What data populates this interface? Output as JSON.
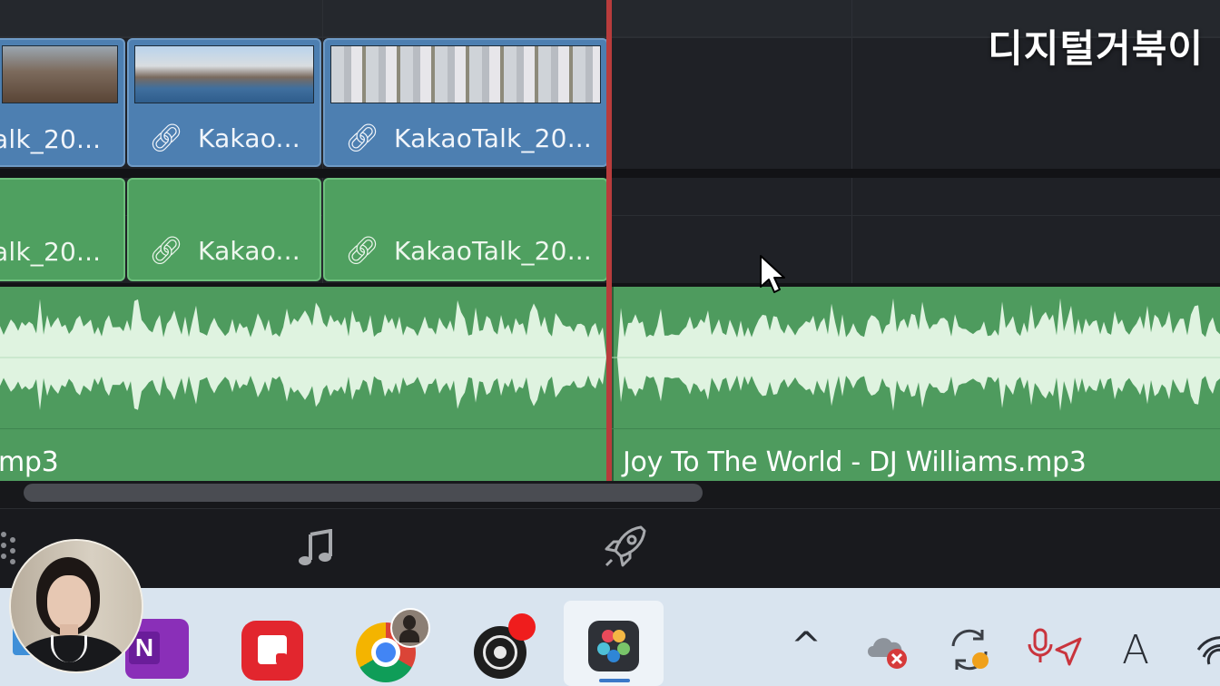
{
  "watermark": "디지털거북이",
  "video_clips": [
    {
      "label": "alk_20...",
      "linked": false
    },
    {
      "label": "Kakao...",
      "linked": true
    },
    {
      "label": "KakaoTalk_20...",
      "linked": true
    }
  ],
  "audio_clips": [
    {
      "label": "alk_20...",
      "linked": false
    },
    {
      "label": "Kakao...",
      "linked": true
    },
    {
      "label": "KakaoTalk_20...",
      "linked": true
    }
  ],
  "music_clips": [
    {
      "label": "mp3"
    },
    {
      "label": "Joy To The World - DJ Williams.mp3"
    }
  ],
  "page_tabs": [
    {
      "icon": "media-dots-icon",
      "name": "media"
    },
    {
      "icon": "music-note-icon",
      "name": "fairlight"
    },
    {
      "icon": "rocket-icon",
      "name": "deliver"
    }
  ],
  "taskbar": {
    "apps": [
      {
        "icon": "file-explorer-icon"
      },
      {
        "icon": "onenote-icon",
        "letter": "N"
      },
      {
        "icon": "sticky-notes-icon"
      },
      {
        "icon": "chrome-icon"
      },
      {
        "icon": "obs-studio-icon"
      },
      {
        "icon": "davinci-resolve-icon",
        "active": true
      }
    ],
    "tray": [
      {
        "icon": "chevron-up-icon",
        "glyph": "^"
      },
      {
        "icon": "onedrive-error-icon"
      },
      {
        "icon": "sync-icon"
      },
      {
        "icon": "microphone-location-icon"
      },
      {
        "icon": "input-method-icon",
        "glyph": "A"
      },
      {
        "icon": "wifi-icon"
      }
    ]
  },
  "colors": {
    "video_clip": "#4d7fb1",
    "audio_clip": "#4fa060",
    "playhead": "#b83c3c",
    "waveform": "#dff3e0"
  }
}
